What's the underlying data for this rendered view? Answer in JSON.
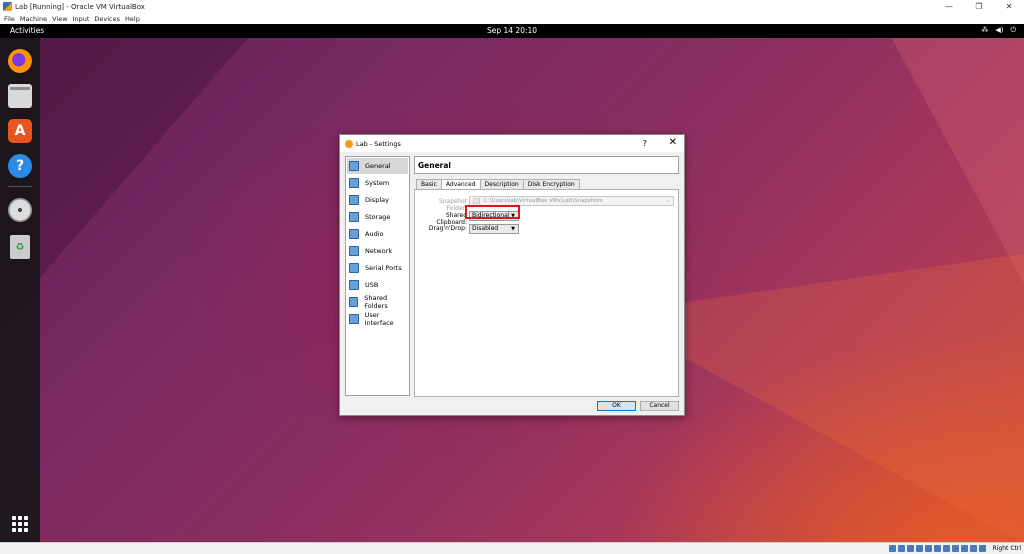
{
  "host_window": {
    "title": "Lab [Running] - Oracle VM VirtualBox",
    "controls": {
      "minimize": "—",
      "maximize": "❐",
      "close": "✕"
    },
    "menu": [
      "File",
      "Machine",
      "View",
      "Input",
      "Devices",
      "Help"
    ]
  },
  "guest_topbar": {
    "activities": "Activities",
    "clock": "Sep 14  20:10",
    "tray": {
      "network": "⁂",
      "volume": "◀)",
      "power": "⏻"
    }
  },
  "dock": {
    "items": [
      "firefox-icon",
      "files-icon",
      "software-icon",
      "help-icon",
      "disc-icon",
      "trash-icon"
    ]
  },
  "dialog": {
    "title": "Lab - Settings",
    "help_button": "?",
    "close_button": "✕",
    "categories": [
      "General",
      "System",
      "Display",
      "Storage",
      "Audio",
      "Network",
      "Serial Ports",
      "USB",
      "Shared Folders",
      "User Interface"
    ],
    "selected_category": "General",
    "section_title": "General",
    "tabs": [
      "Basic",
      "Advanced",
      "Description",
      "Disk Encryption"
    ],
    "active_tab": "Advanced",
    "snapshot_folder_label": "Snapshot Folder:",
    "snapshot_folder_value": "C:\\Users\\lab\\VirtualBox VMs\\Lab\\Snapshots",
    "shared_clipboard_label": "Shared Clipboard:",
    "shared_clipboard_value": "Bidirectional",
    "dragndrop_label": "Drag'n'Drop:",
    "dragndrop_value": "Disabled",
    "ok_label": "OK",
    "cancel_label": "Cancel"
  },
  "host_status": {
    "host_key": "Right Ctrl"
  },
  "colors": {
    "highlight": "#e0141e",
    "ubuntu_orange": "#e95420"
  }
}
